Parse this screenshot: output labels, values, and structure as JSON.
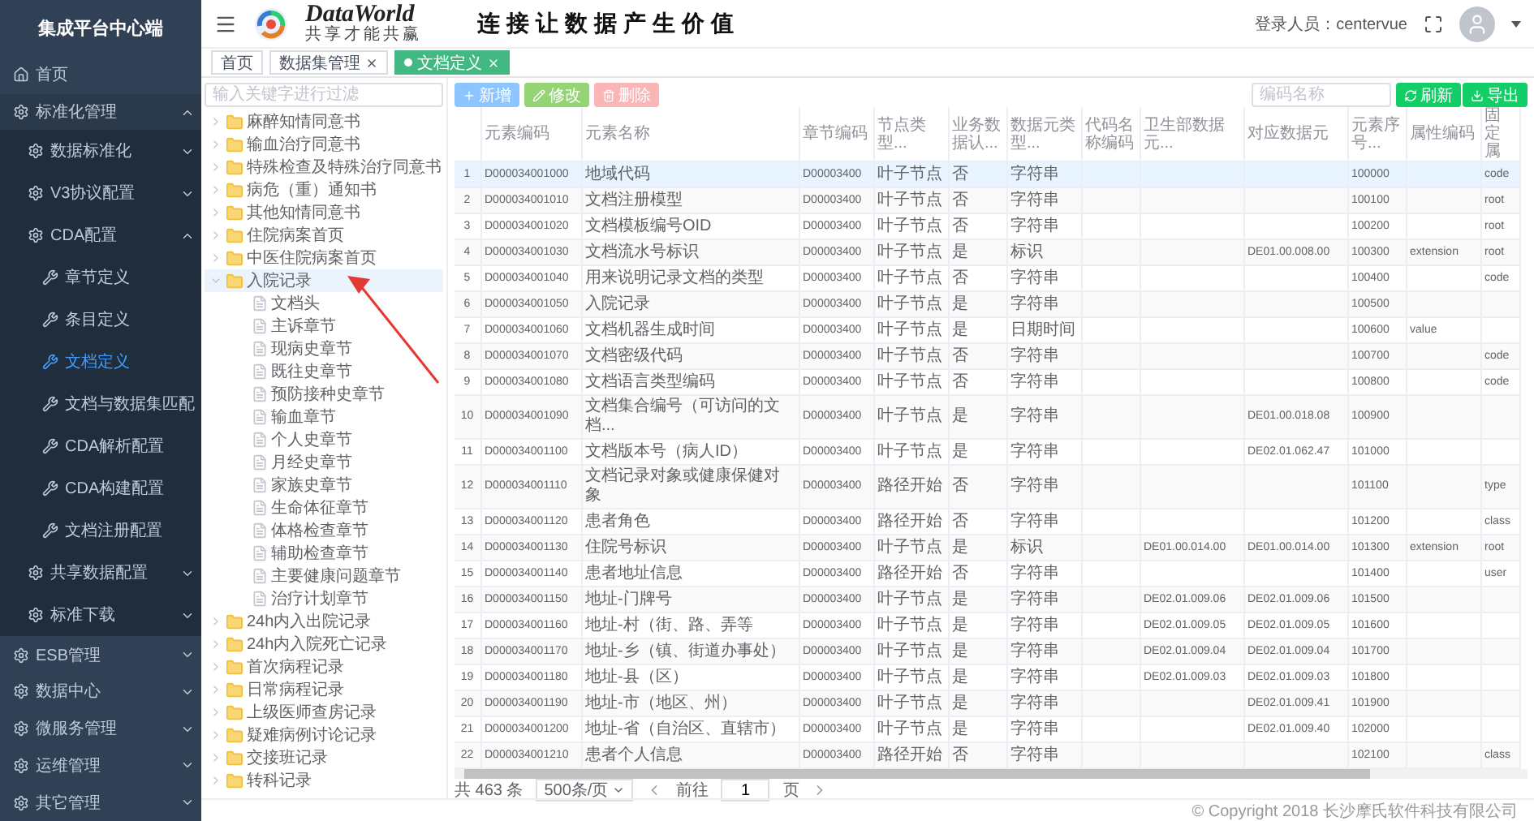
{
  "sidebar": {
    "title": "集成平台中心端",
    "items": [
      {
        "kind": "link",
        "label": "首页",
        "selected": false
      },
      {
        "kind": "group",
        "label": "标准化管理",
        "expanded": true,
        "children": [
          {
            "kind": "group",
            "label": "数据标准化",
            "expanded": false
          },
          {
            "kind": "group",
            "label": "V3协议配置",
            "expanded": false
          },
          {
            "kind": "group",
            "label": "CDA配置",
            "expanded": true,
            "children": [
              {
                "kind": "link",
                "label": "章节定义",
                "selected": false
              },
              {
                "kind": "link",
                "label": "条目定义",
                "selected": false
              },
              {
                "kind": "link",
                "label": "文档定义",
                "selected": true
              },
              {
                "kind": "link",
                "label": "文档与数据集匹配",
                "selected": false
              },
              {
                "kind": "link",
                "label": "CDA解析配置",
                "selected": false
              },
              {
                "kind": "link",
                "label": "CDA构建配置",
                "selected": false
              },
              {
                "kind": "link",
                "label": "文档注册配置",
                "selected": false
              }
            ]
          },
          {
            "kind": "group",
            "label": "共享数据配置",
            "expanded": false
          },
          {
            "kind": "group",
            "label": "标准下载",
            "expanded": false
          }
        ]
      },
      {
        "kind": "group",
        "label": "ESB管理",
        "expanded": false
      },
      {
        "kind": "group",
        "label": "数据中心",
        "expanded": false
      },
      {
        "kind": "group",
        "label": "微服务管理",
        "expanded": false
      },
      {
        "kind": "group",
        "label": "运维管理",
        "expanded": false
      },
      {
        "kind": "group",
        "label": "其它管理",
        "expanded": false
      }
    ]
  },
  "header": {
    "brand": "DataWorld",
    "tagline": "共享才能共赢",
    "slogan": "连接让数据产生价值",
    "user": "登录人员：centervue"
  },
  "tabs": [
    {
      "label": "首页",
      "closable": false,
      "selected": false
    },
    {
      "label": "数据集管理",
      "closable": true,
      "selected": false
    },
    {
      "label": "文档定义",
      "closable": true,
      "selected": true
    }
  ],
  "tree": {
    "filter_placeholder": "输入关键字进行过滤",
    "nodes": [
      {
        "kind": "folder",
        "label": "麻醉知情同意书",
        "expanded": false,
        "selected": false
      },
      {
        "kind": "folder",
        "label": "输血治疗同意书",
        "expanded": false,
        "selected": false
      },
      {
        "kind": "folder",
        "label": "特殊检查及特殊治疗同意书",
        "expanded": false,
        "selected": false
      },
      {
        "kind": "folder",
        "label": "病危（重）通知书",
        "expanded": false,
        "selected": false
      },
      {
        "kind": "folder",
        "label": "其他知情同意书",
        "expanded": false,
        "selected": false
      },
      {
        "kind": "folder",
        "label": "住院病案首页",
        "expanded": false,
        "selected": false
      },
      {
        "kind": "folder",
        "label": "中医住院病案首页",
        "expanded": false,
        "selected": false
      },
      {
        "kind": "folder",
        "label": "入院记录",
        "expanded": true,
        "selected": true,
        "children": [
          {
            "kind": "document",
            "label": "文档头",
            "selected": false
          },
          {
            "kind": "document",
            "label": "主诉章节",
            "selected": false
          },
          {
            "kind": "document",
            "label": "现病史章节",
            "selected": false
          },
          {
            "kind": "document",
            "label": "既往史章节",
            "selected": false
          },
          {
            "kind": "document",
            "label": "预防接种史章节",
            "selected": false
          },
          {
            "kind": "document",
            "label": "输血章节",
            "selected": false
          },
          {
            "kind": "document",
            "label": "个人史章节",
            "selected": false
          },
          {
            "kind": "document",
            "label": "月经史章节",
            "selected": false
          },
          {
            "kind": "document",
            "label": "家族史章节",
            "selected": false
          },
          {
            "kind": "document",
            "label": "生命体征章节",
            "selected": false
          },
          {
            "kind": "document",
            "label": "体格检查章节",
            "selected": false
          },
          {
            "kind": "document",
            "label": "辅助检查章节",
            "selected": false
          },
          {
            "kind": "document",
            "label": "主要健康问题章节",
            "selected": false
          },
          {
            "kind": "document",
            "label": "治疗计划章节",
            "selected": false
          }
        ]
      },
      {
        "kind": "folder",
        "label": "24h内入出院记录",
        "expanded": false,
        "selected": false
      },
      {
        "kind": "folder",
        "label": "24h内入院死亡记录",
        "expanded": false,
        "selected": false
      },
      {
        "kind": "folder",
        "label": "首次病程记录",
        "expanded": false,
        "selected": false
      },
      {
        "kind": "folder",
        "label": "日常病程记录",
        "expanded": false,
        "selected": false
      },
      {
        "kind": "folder",
        "label": "上级医师查房记录",
        "expanded": false,
        "selected": false
      },
      {
        "kind": "folder",
        "label": "疑难病例讨论记录",
        "expanded": false,
        "selected": false
      },
      {
        "kind": "folder",
        "label": "交接班记录",
        "expanded": false,
        "selected": false
      },
      {
        "kind": "folder",
        "label": "转科记录",
        "expanded": false,
        "selected": false
      }
    ]
  },
  "toolbar": {
    "buttons": [
      {
        "kind": "add",
        "label": "新增"
      },
      {
        "kind": "edit",
        "label": "修改"
      },
      {
        "kind": "delete",
        "label": "删除"
      }
    ],
    "search_placeholder": "编码名称",
    "actions": [
      {
        "kind": "refresh",
        "label": "刷新"
      },
      {
        "kind": "export",
        "label": "导出"
      }
    ]
  },
  "table": {
    "columns": [
      "",
      "元素编码",
      "元素名称",
      "章节编码",
      "节点类型...",
      "业务数据认...",
      "数据元类型...",
      "代码名称编码",
      "卫生部数据元...",
      "对应数据元",
      "元素序号...",
      "属性编码",
      "固定属"
    ],
    "rows": [
      {
        "selected": true,
        "cells": [
          "1",
          "D000034001000",
          "地域代码",
          "D00003400",
          "叶子节点",
          "否",
          "字符串",
          null,
          null,
          null,
          "100000",
          null,
          "code"
        ]
      },
      {
        "selected": false,
        "cells": [
          "2",
          "D000034001010",
          "文档注册模型",
          "D00003400",
          "叶子节点",
          "否",
          "字符串",
          null,
          null,
          null,
          "100100",
          null,
          "root"
        ]
      },
      {
        "selected": false,
        "cells": [
          "3",
          "D000034001020",
          "文档模板编号OID",
          "D00003400",
          "叶子节点",
          "否",
          "字符串",
          null,
          null,
          null,
          "100200",
          null,
          "root"
        ]
      },
      {
        "selected": false,
        "cells": [
          "4",
          "D000034001030",
          "文档流水号标识",
          "D00003400",
          "叶子节点",
          "是",
          "标识",
          null,
          null,
          "DE01.00.008.00",
          "100300",
          "extension",
          "root"
        ]
      },
      {
        "selected": false,
        "cells": [
          "5",
          "D000034001040",
          "用来说明记录文档的类型",
          "D00003400",
          "叶子节点",
          "否",
          "字符串",
          null,
          null,
          null,
          "100400",
          null,
          "code"
        ]
      },
      {
        "selected": false,
        "cells": [
          "6",
          "D000034001050",
          "入院记录",
          "D00003400",
          "叶子节点",
          "是",
          "字符串",
          null,
          null,
          null,
          "100500",
          null,
          null
        ]
      },
      {
        "selected": false,
        "cells": [
          "7",
          "D000034001060",
          "文档机器生成时间",
          "D00003400",
          "叶子节点",
          "是",
          "日期时间",
          null,
          null,
          null,
          "100600",
          "value",
          null
        ]
      },
      {
        "selected": false,
        "cells": [
          "8",
          "D000034001070",
          "文档密级代码",
          "D00003400",
          "叶子节点",
          "否",
          "字符串",
          null,
          null,
          null,
          "100700",
          null,
          "code"
        ]
      },
      {
        "selected": false,
        "cells": [
          "9",
          "D000034001080",
          "文档语言类型编码",
          "D00003400",
          "叶子节点",
          "否",
          "字符串",
          null,
          null,
          null,
          "100800",
          null,
          "code"
        ]
      },
      {
        "selected": false,
        "cells": [
          "10",
          "D000034001090",
          "文档集合编号（可访问的文档...",
          "D00003400",
          "叶子节点",
          "是",
          "字符串",
          null,
          null,
          "DE01.00.018.08",
          "100900",
          null,
          null
        ]
      },
      {
        "selected": false,
        "cells": [
          "11",
          "D000034001100",
          "文档版本号（病人ID）",
          "D00003400",
          "叶子节点",
          "是",
          "字符串",
          null,
          null,
          "DE02.01.062.47",
          "101000",
          null,
          null
        ]
      },
      {
        "selected": false,
        "cells": [
          "12",
          "D000034001110",
          "文档记录对象或健康保健对象",
          "D00003400",
          "路径开始",
          "否",
          "字符串",
          null,
          null,
          null,
          "101100",
          null,
          "type"
        ]
      },
      {
        "selected": false,
        "cells": [
          "13",
          "D000034001120",
          "患者角色",
          "D00003400",
          "路径开始",
          "否",
          "字符串",
          null,
          null,
          null,
          "101200",
          null,
          "class"
        ]
      },
      {
        "selected": false,
        "cells": [
          "14",
          "D000034001130",
          "住院号标识",
          "D00003400",
          "叶子节点",
          "是",
          "标识",
          null,
          "DE01.00.014.00",
          "DE01.00.014.00",
          "101300",
          "extension",
          "root"
        ]
      },
      {
        "selected": false,
        "cells": [
          "15",
          "D000034001140",
          "患者地址信息",
          "D00003400",
          "路径开始",
          "否",
          "字符串",
          null,
          null,
          null,
          "101400",
          null,
          "user"
        ]
      },
      {
        "selected": false,
        "cells": [
          "16",
          "D000034001150",
          "地址-门牌号",
          "D00003400",
          "叶子节点",
          "是",
          "字符串",
          null,
          "DE02.01.009.06",
          "DE02.01.009.06",
          "101500",
          null,
          null
        ]
      },
      {
        "selected": false,
        "cells": [
          "17",
          "D000034001160",
          "地址-村（街、路、弄等",
          "D00003400",
          "叶子节点",
          "是",
          "字符串",
          null,
          "DE02.01.009.05",
          "DE02.01.009.05",
          "101600",
          null,
          null
        ]
      },
      {
        "selected": false,
        "cells": [
          "18",
          "D000034001170",
          "地址-乡（镇、街道办事处）",
          "D00003400",
          "叶子节点",
          "是",
          "字符串",
          null,
          "DE02.01.009.04",
          "DE02.01.009.04",
          "101700",
          null,
          null
        ]
      },
      {
        "selected": false,
        "cells": [
          "19",
          "D000034001180",
          "地址-县（区）",
          "D00003400",
          "叶子节点",
          "是",
          "字符串",
          null,
          "DE02.01.009.03",
          "DE02.01.009.03",
          "101800",
          null,
          null
        ]
      },
      {
        "selected": false,
        "cells": [
          "20",
          "D000034001190",
          "地址-市（地区、州）",
          "D00003400",
          "叶子节点",
          "是",
          "字符串",
          null,
          null,
          "DE02.01.009.41",
          "101900",
          null,
          null
        ]
      },
      {
        "selected": false,
        "cells": [
          "21",
          "D000034001200",
          "地址-省（自治区、直辖市）",
          "D00003400",
          "叶子节点",
          "是",
          "字符串",
          null,
          null,
          "DE02.01.009.40",
          "102000",
          null,
          null
        ]
      },
      {
        "selected": false,
        "cells": [
          "22",
          "D000034001210",
          "患者个人信息",
          "D00003400",
          "路径开始",
          "否",
          "字符串",
          null,
          null,
          null,
          "102100",
          null,
          "class"
        ]
      }
    ]
  },
  "pagination": {
    "total": "共 463 条",
    "page_size": "500条/页",
    "goto": "前往",
    "page": "1",
    "page_suffix": "页"
  },
  "footer": "© Copyright 2018 长沙摩氏软件科技有限公司"
}
